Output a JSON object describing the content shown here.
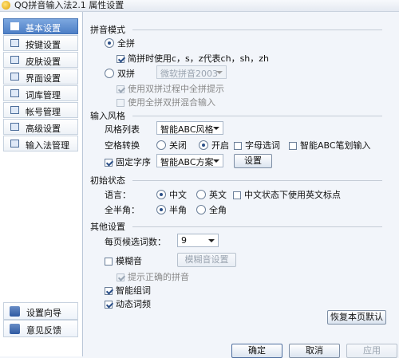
{
  "window": {
    "title": "QQ拼音输入法2.1 属性设置"
  },
  "sidebar": {
    "items": [
      {
        "label": "基本设置",
        "icon": "settings-icon"
      },
      {
        "label": "按键设置",
        "icon": "keyboard-icon"
      },
      {
        "label": "皮肤设置",
        "icon": "shirt-icon"
      },
      {
        "label": "界面设置",
        "icon": "interface-icon"
      },
      {
        "label": "词库管理",
        "icon": "dictionary-icon"
      },
      {
        "label": "帐号管理",
        "icon": "account-icon"
      },
      {
        "label": "高级设置",
        "icon": "advanced-icon"
      },
      {
        "label": "输入法管理",
        "icon": "ime-manage-icon"
      }
    ],
    "bottom": [
      {
        "label": "设置向导",
        "icon": "wizard-icon"
      },
      {
        "label": "意见反馈",
        "icon": "feedback-icon"
      }
    ]
  },
  "pinyin": {
    "title": "拼音模式",
    "full": "全拼",
    "simplified": "简拼时使用c，s，z代表ch，sh，zh",
    "shuangpin": "双拼",
    "shuangpin_scheme": "微软拼音2003",
    "show_full_in_shuangpin": "使用双拼过程中全拼提示",
    "mixed_input": "使用全拼双拼混合输入"
  },
  "style": {
    "title": "输入风格",
    "list_label": "风格列表",
    "list_value": "智能ABC风格",
    "space_label": "空格转换",
    "space_off": "关闭",
    "space_on": "开启",
    "letter_select": "字母选词",
    "abc_stroke": "智能ABC笔划输入",
    "fixed_order": "固定字序",
    "scheme_value": "智能ABC方案",
    "settings_button": "设置"
  },
  "init": {
    "title": "初始状态",
    "lang_label": "语言：",
    "chinese": "中文",
    "english": "英文",
    "eng_punct": "中文状态下使用英文标点",
    "width_label": "全半角：",
    "half": "半角",
    "full": "全角"
  },
  "other": {
    "title": "其他设置",
    "candidates_label": "每页候选词数：",
    "candidates_value": "9",
    "fuzzy": "模糊音",
    "fuzzy_settings": "模糊音设置",
    "hint_correct": "提示正确的拼音",
    "smart_group": "智能组词",
    "dynamic_freq": "动态词频",
    "restore_button": "恢复本页默认"
  },
  "footer": {
    "ok": "确定",
    "cancel": "取消",
    "apply": "应用"
  }
}
